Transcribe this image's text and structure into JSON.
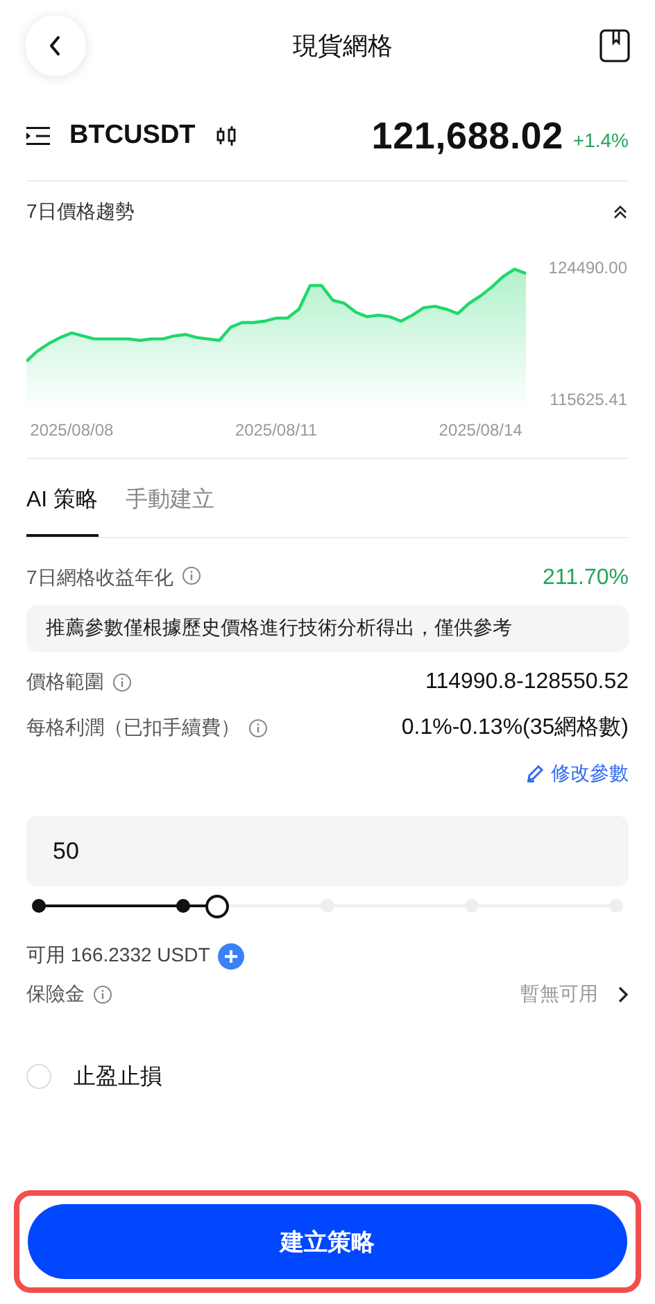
{
  "header": {
    "title": "現貨網格"
  },
  "ticker": {
    "symbol": "BTCUSDT",
    "price": "121,688.02",
    "change": "+1.4%"
  },
  "trend": {
    "title": "7日價格趨勢",
    "expanded": true,
    "chart_data": {
      "type": "area",
      "categories": [
        null,
        null,
        null,
        null,
        "2025/08/08",
        null,
        null,
        null,
        null,
        null,
        null,
        null,
        null,
        null,
        null,
        null,
        null,
        null,
        null,
        null,
        null,
        null,
        "2025/08/11",
        null,
        null,
        null,
        null,
        null,
        null,
        null,
        null,
        null,
        null,
        null,
        null,
        null,
        null,
        null,
        null,
        null,
        "2025/08/14",
        null,
        null,
        null,
        null
      ],
      "series": [
        {
          "color": "#1fd86a",
          "values": [
            118200,
            118900,
            119400,
            119800,
            120100,
            119900,
            119700,
            119700,
            119700,
            119700,
            119600,
            119700,
            119700,
            119900,
            120000,
            119800,
            119700,
            119600,
            120500,
            120800,
            120800,
            120900,
            121100,
            121100,
            121700,
            123300,
            123300,
            122300,
            122100,
            121500,
            121200,
            121300,
            121200,
            120900,
            121300,
            121800,
            121900,
            121700,
            121400,
            122100,
            122600,
            123200,
            123900,
            124400,
            124100
          ]
        }
      ],
      "ylim": [
        115625.41,
        124490.0
      ],
      "yticks": [
        {
          "value": 124490.0,
          "label": "124490.00"
        },
        {
          "value": 115625.41,
          "label": "115625.41"
        }
      ]
    }
  },
  "tabs": [
    {
      "label": "AI 策略",
      "selected": true
    },
    {
      "label": "手動建立",
      "selected": false
    }
  ],
  "annualized": {
    "label": "7日網格收益年化",
    "value": "211.70%"
  },
  "notice": "推薦參數僅根據歷史價格進行技術分析得出，僅供參考",
  "params": [
    {
      "label": "價格範圍",
      "value": "114990.8-128550.52"
    },
    {
      "label": "每格利潤（已扣手續費）",
      "value": "0.1%-0.13%(35網格數)"
    }
  ],
  "edit_link": "修改參數",
  "amount": {
    "value": "50",
    "level": 0.31
  },
  "available": "可用 166.2332 USDT",
  "insurance": {
    "label": "保險金",
    "value": "暫無可用"
  },
  "tp_sl": {
    "label": "止盈止損",
    "checked": false
  },
  "submit": {
    "label": "建立策略",
    "highlighted": true
  }
}
